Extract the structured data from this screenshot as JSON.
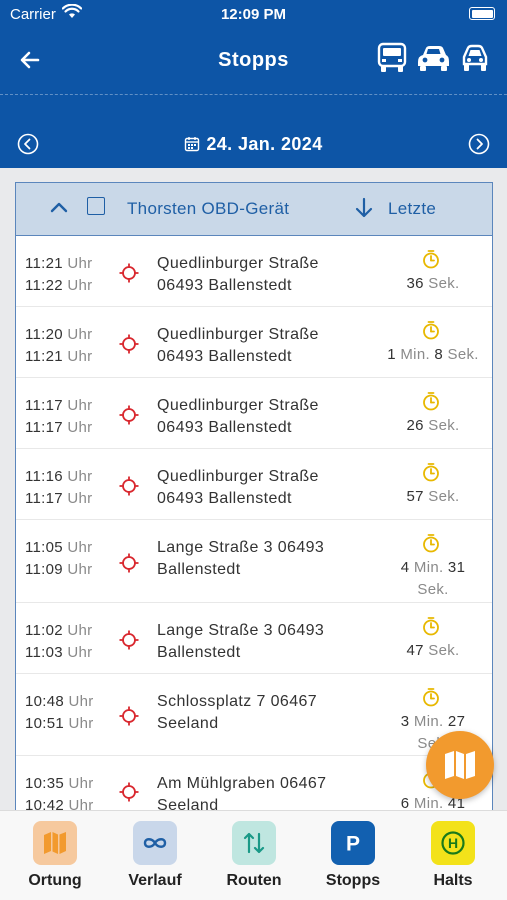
{
  "status_bar": {
    "carrier": "Carrier",
    "time": "12:09 PM"
  },
  "header": {
    "title": "Stopps",
    "vehicle_icons": [
      "truck-icon",
      "car-icon",
      "car-front-icon"
    ]
  },
  "date_nav": {
    "date": "24. Jan. 2024"
  },
  "list_header": {
    "vehicle": "Thorsten OBD-Gerät",
    "sort": "Letzte"
  },
  "stops": [
    {
      "start": "11:21",
      "end": "11:22",
      "unit": "Uhr",
      "address1": "Quedlinburger Straße",
      "address2": "06493 Ballenstedt",
      "dur_line1": "36 Sek.",
      "dur_line2": ""
    },
    {
      "start": "11:20",
      "end": "11:21",
      "unit": "Uhr",
      "address1": "Quedlinburger Straße",
      "address2": "06493 Ballenstedt",
      "dur_line1": "1 Min. 8 Sek.",
      "dur_line2": ""
    },
    {
      "start": "11:17",
      "end": "11:17",
      "unit": "Uhr",
      "address1": "Quedlinburger Straße",
      "address2": "06493 Ballenstedt",
      "dur_line1": "26 Sek.",
      "dur_line2": ""
    },
    {
      "start": "11:16",
      "end": "11:17",
      "unit": "Uhr",
      "address1": "Quedlinburger Straße",
      "address2": "06493 Ballenstedt",
      "dur_line1": "57 Sek.",
      "dur_line2": ""
    },
    {
      "start": "11:05",
      "end": "11:09",
      "unit": "Uhr",
      "address1": "Lange Straße 3 06493",
      "address2": "Ballenstedt",
      "dur_line1": "4 Min. 31",
      "dur_line2": "Sek."
    },
    {
      "start": "11:02",
      "end": "11:03",
      "unit": "Uhr",
      "address1": "Lange Straße 3 06493",
      "address2": "Ballenstedt",
      "dur_line1": "47 Sek.",
      "dur_line2": ""
    },
    {
      "start": "10:48",
      "end": "10:51",
      "unit": "Uhr",
      "address1": "Schlossplatz 7 06467",
      "address2": "Seeland",
      "dur_line1": "3 Min. 27",
      "dur_line2": "Sek."
    },
    {
      "start": "10:35",
      "end": "10:42",
      "unit": "Uhr",
      "address1": "Am Mühlgraben 06467",
      "address2": "Seeland",
      "dur_line1": "6 Min. 41",
      "dur_line2": ""
    }
  ],
  "fab": {
    "icon": "map-icon"
  },
  "tabs": [
    {
      "label": "Ortung",
      "icon": "map-icon",
      "color": "#f6c99e"
    },
    {
      "label": "Verlauf",
      "icon": "infinity-icon",
      "color": "#c9d7ea"
    },
    {
      "label": "Routen",
      "icon": "route-swap-icon",
      "color": "#bfe6e0"
    },
    {
      "label": "Stopps",
      "icon": "parking-icon",
      "color": "#1260b0"
    },
    {
      "label": "Halts",
      "icon": "bus-stop-icon",
      "color": "#f3e21a"
    }
  ],
  "colors": {
    "header": "#0d55a6",
    "accent": "#1f5fa5",
    "pin": "#d9282f",
    "clock": "#e8b800",
    "fab": "#f29a2e"
  }
}
